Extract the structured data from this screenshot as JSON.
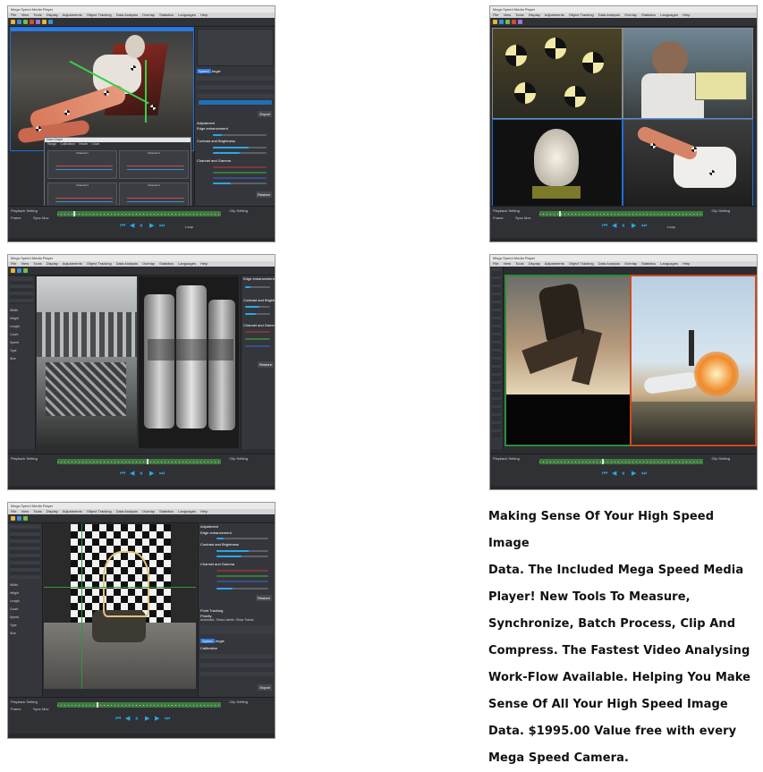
{
  "screenshots": [
    {
      "title": "Mega Speed Media Player",
      "menu": [
        "File",
        "View",
        "Tools",
        "Display",
        "Adjustments",
        "Object Tracking",
        "Data Analysis",
        "Overlay",
        "Statistics",
        "Languages",
        "Help"
      ],
      "panel_labels": {
        "data": "Data Graph",
        "speed": "Speed",
        "angle": "Angle",
        "adjust": "Adjustment",
        "edge": "Edge enhancement",
        "level": "Level",
        "contrast": "Contrast and Brightness",
        "gain": "Gain",
        "bias": "Bias",
        "channel": "Channel and Gamma",
        "gamma": "Gamma",
        "export": "Export",
        "restore": "Restore",
        "playback": "Playback Setting",
        "frame": "Frame",
        "sync": "Sync Mov",
        "clip": "Clip Setting",
        "loop": "Loop"
      },
      "graph": {
        "range": "Range",
        "calibration": "Calibration",
        "viewer": "Viewer",
        "chart": "Chart",
        "ch1": "Channel 1",
        "ch2": "Channel 2",
        "ch3": "Channel 3",
        "ch4": "Channel 4"
      }
    },
    {
      "title": "Mega Speed Media Player",
      "menu": [
        "File",
        "View",
        "Tools",
        "Display",
        "Adjustments",
        "Object Tracking",
        "Data Analysis",
        "Overlay",
        "Statistics",
        "Languages",
        "Help"
      ],
      "labels": {
        "playback": "Playback Setting",
        "frame": "Frame",
        "sync": "Sync Mov",
        "clip": "Clip Setting",
        "loop": "Loop"
      }
    },
    {
      "title": "Mega Speed Media Player",
      "menu": [
        "File",
        "View",
        "Tools",
        "Display",
        "Adjustments",
        "Object Tracking",
        "Data Analysis",
        "Overlay",
        "Statistics",
        "Languages",
        "Help"
      ],
      "labels": {
        "edge": "Edge enhancement",
        "contrast": "Contrast and Brightness",
        "channel": "Channel and Gamma",
        "restore": "Restore",
        "playback": "Playback Setting",
        "clip": "Clip Setting"
      },
      "info": [
        "Width",
        "Height",
        "Length",
        "Count",
        "Speed",
        "Type",
        "Size"
      ]
    },
    {
      "title": "Mega Speed Media Player",
      "menu": [
        "File",
        "View",
        "Tools",
        "Display",
        "Adjustments",
        "Object Tracking",
        "Data Analysis",
        "Overlay",
        "Statistics",
        "Languages",
        "Help"
      ],
      "labels": {
        "playback": "Playback Setting",
        "clip": "Clip Setting"
      }
    },
    {
      "title": "Mega Speed Media Player",
      "menu": [
        "File",
        "View",
        "Tools",
        "Display",
        "Adjustments",
        "Object Tracking",
        "Data Analysis",
        "Overlay",
        "Statistics",
        "Languages",
        "Help"
      ],
      "labels": {
        "adjust": "Adjustment",
        "edge": "Edge enhancement",
        "level": "Level",
        "contrast": "Contrast and Brightness",
        "gain": "Gain",
        "bias": "Bias",
        "channel": "Channel and Gamma",
        "gamma": "Gamma",
        "restore": "Restore",
        "tracking": "Point Tracking",
        "priority": "Priority",
        "automatic": "Automatic",
        "show_labels": "Show Labels",
        "show_tracks": "Show Tracks",
        "speed": "Speed",
        "angle": "Angle",
        "calibration": "Calibration",
        "export": "Export",
        "playback": "Playback Setting",
        "frame": "Frame",
        "sync": "Sync Mov",
        "clip": "Clip Setting"
      },
      "info": [
        "Width",
        "Height",
        "Length",
        "Count",
        "Speed",
        "Type",
        "Size"
      ]
    }
  ],
  "description_lines": [
    "Making Sense Of Your High Speed Image",
    "Data. The Included Mega Speed Media",
    "Player! New Tools To Measure,",
    "Synchronize, Batch Process, Clip And",
    "Compress. The Fastest Video Analysing",
    "Work-Flow Available. Helping You Make",
    "Sense Of All Your High Speed Image",
    "Data. $1995.00 Value free with every",
    "Mega Speed Camera."
  ],
  "colors": {
    "ui_dark": "#2b2d31",
    "accent_blue": "#2aa7e6",
    "timeline_green": "#3e7a3e",
    "frame_red": "#d04a1e",
    "frame_green": "#2f8a3a"
  }
}
